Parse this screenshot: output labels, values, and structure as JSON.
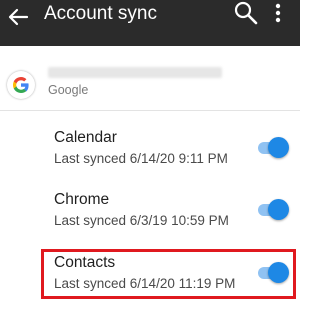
{
  "app_bar": {
    "title": "Account sync",
    "back_icon": "arrow-back-icon",
    "search_icon": "search-icon",
    "more_icon": "more-vert-icon",
    "background": "#2b2b2b"
  },
  "account": {
    "provider": "Google",
    "logo_icon": "google-logo-icon"
  },
  "sync_items": [
    {
      "name": "Calendar",
      "status": "Last synced 6/14/20 9:11 PM",
      "enabled": true
    },
    {
      "name": "Chrome",
      "status": "Last synced 6/3/19 10:59 PM",
      "enabled": true
    },
    {
      "name": "Contacts",
      "status": "Last synced 6/14/20 11:19 PM",
      "enabled": true,
      "highlighted": true
    }
  ],
  "colors": {
    "toggle_thumb": "#1e88e5",
    "toggle_track": "#90c2f2",
    "highlight_border": "#e0191f"
  }
}
